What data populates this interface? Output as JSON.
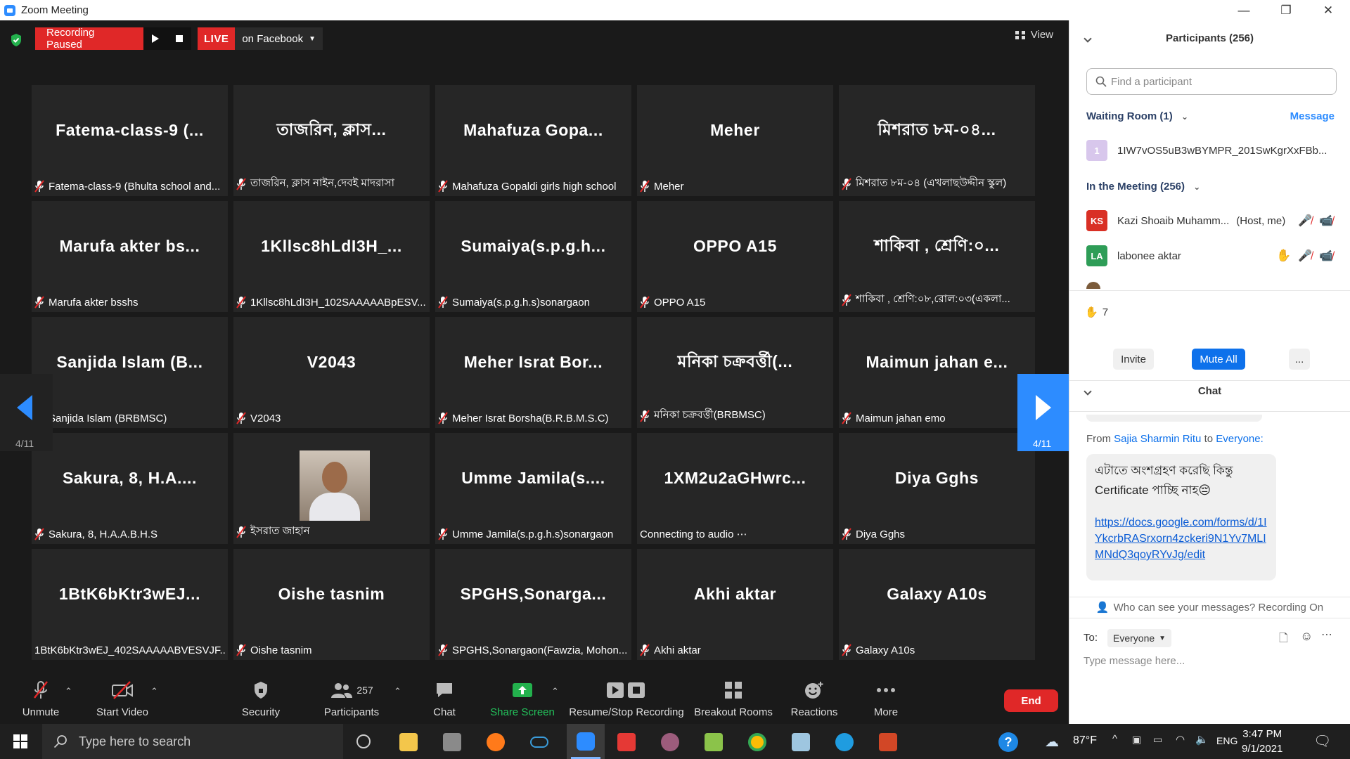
{
  "window": {
    "title": "Zoom Meeting"
  },
  "top": {
    "recording_label": "Recording Paused",
    "live_label": "LIVE",
    "live_target": "on Facebook",
    "view_label": "View"
  },
  "tiles": [
    {
      "big": "Fatema-class-9  (...",
      "name": "Fatema-class-9 (Bhulta school and...",
      "muted": true
    },
    {
      "big": "তাজরিন, ক্লাস...",
      "name": "তাজরিন, ক্লাস নাইন,দেবই মাদরাসা",
      "muted": true
    },
    {
      "big": "Mahafuza  Gopa...",
      "name": "Mahafuza Gopaldi girls high school",
      "muted": true
    },
    {
      "big": "Meher",
      "name": "Meher",
      "muted": true
    },
    {
      "big": "মিশরাত ৮ম-০৪...",
      "name": "মিশরাত ৮ম-০৪ (এখলাছউদ্দীন স্কুল)",
      "muted": true
    },
    {
      "big": "Marufa  akter  bs...",
      "name": "Marufa akter bsshs",
      "muted": true
    },
    {
      "big": "1Kllsc8hLdI3H_...",
      "name": "1Kllsc8hLdI3H_102SAAAAABpESV...",
      "muted": true
    },
    {
      "big": "Sumaiya(s.p.g.h...",
      "name": "Sumaiya(s.p.g.h.s)sonargaon",
      "muted": true
    },
    {
      "big": "OPPO  A15",
      "name": "OPPO A15",
      "muted": true
    },
    {
      "big": "শাকিবা , শ্রেণি:০...",
      "name": "শাকিবা , শ্রেণি:০৮,রোল:০৩(একলা...",
      "muted": true
    },
    {
      "big": "Sanjida  Islam  (B...",
      "name": "Sanjida Islam (BRBMSC)",
      "muted": true
    },
    {
      "big": "V2043",
      "name": "V2043",
      "muted": true
    },
    {
      "big": "Meher  Israt  Bor...",
      "name": "Meher Israt Borsha(B.R.B.M.S.C)",
      "muted": true
    },
    {
      "big": "মনিকা চক্রবর্ত্তী(...",
      "name": "মনিকা চক্রবর্ত্তী(BRBMSC)",
      "muted": true
    },
    {
      "big": "Maimun  jahan  e...",
      "name": "Maimun jahan emo",
      "muted": true
    },
    {
      "big": "Sakura,  8,  H.A....",
      "name": "Sakura,  8, H.A.A.B.H.S",
      "muted": true
    },
    {
      "big": "",
      "name": "ইসরাত জাহান",
      "muted": true,
      "photo": true
    },
    {
      "big": "Umme  Jamila(s....",
      "name": "Umme Jamila(s.p.g.h.s)sonargaon",
      "muted": true
    },
    {
      "big": "1XM2u2aGHwrc...",
      "name": "Connecting to audio ⋯",
      "muted": false
    },
    {
      "big": "Diya  Gghs",
      "name": "Diya  Gghs",
      "muted": true
    },
    {
      "big": "1BtK6bKtr3wEJ...",
      "name": "1BtK6bKtr3wEJ_402SAAAAABVESVJF...",
      "muted": false
    },
    {
      "big": "Oishe  tasnim",
      "name": "Oishe tasnim",
      "muted": true
    },
    {
      "big": "SPGHS,Sonarga...",
      "name": "SPGHS,Sonargaon(Fawzia, Mohon...",
      "muted": true
    },
    {
      "big": "Akhi  aktar",
      "name": "Akhi aktar",
      "muted": true
    },
    {
      "big": "Galaxy  A10s",
      "name": "Galaxy A10s",
      "muted": true
    }
  ],
  "pager": {
    "left": "4/11",
    "right": "4/11"
  },
  "toolbar": {
    "unmute": "Unmute",
    "start_video": "Start Video",
    "security": "Security",
    "participants": "Participants",
    "participants_count": "257",
    "chat": "Chat",
    "share_screen": "Share Screen",
    "recording": "Resume/Stop Recording",
    "breakout": "Breakout Rooms",
    "reactions": "Reactions",
    "more": "More",
    "end": "End"
  },
  "panel": {
    "title": "Participants (256)",
    "search_placeholder": "Find a participant",
    "waiting_room": "Waiting Room (1)",
    "message_link": "Message",
    "waiting_user": {
      "initial": "1",
      "name": "1IW7vOS5uB3wBYMPR_201SwKgrXxFBb..."
    },
    "in_meeting": "In the Meeting (256)",
    "host": {
      "initials": "KS",
      "name": "Kazi Shoaib Muhamm...",
      "tag": "(Host, me)",
      "color": "#d93025"
    },
    "p2": {
      "initials": "LA",
      "name": "labonee aktar",
      "color": "#2e9d57"
    },
    "raised_count": "7",
    "invite": "Invite",
    "mute_all": "Mute All",
    "more": "...",
    "chat_title": "Chat",
    "chat_from_prefix": "From",
    "chat_sender": "Sajia Sharmin Ritu",
    "chat_to": "to",
    "chat_recipient": "Everyone:",
    "chat_text_1": "এটাতে অংশগ্রহণ করেছি কিন্তু",
    "chat_text_2": "Certificate পাচ্ছি নাহ😔",
    "chat_link": "https://docs.google.com/forms/d/1IYkcrbRASrxorn4zckeri9N1Yv7MLIMNdQ3qoyRYvJg/edit",
    "who_can_see": "Who can see your messages? Recording On",
    "to_label": "To:",
    "to_value": "Everyone",
    "input_placeholder": "Type message here..."
  },
  "taskbar": {
    "search_placeholder": "Type here to search",
    "temp": "87°F",
    "lang": "ENG",
    "time": "3:47 PM",
    "date": "9/1/2021"
  }
}
